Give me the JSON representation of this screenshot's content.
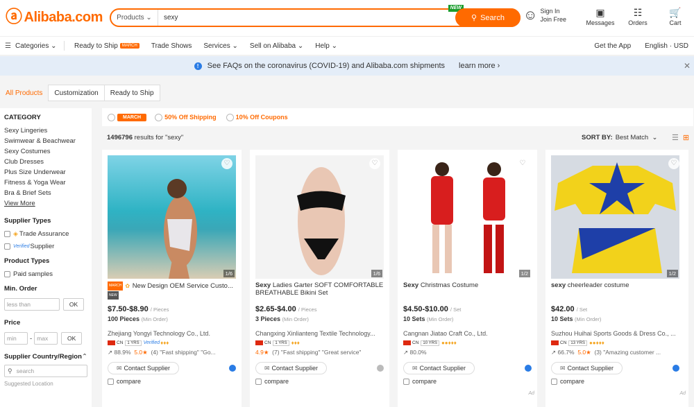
{
  "header": {
    "logo": "Alibaba.com",
    "search": {
      "category": "Products",
      "query": "sexy",
      "button": "Search",
      "new_badge": "NEW"
    },
    "signin": [
      "Sign In",
      "Join Free"
    ],
    "items": [
      "Messages",
      "Orders",
      "Cart"
    ]
  },
  "nav": {
    "categories": "Categories",
    "items": [
      "Ready to Ship",
      "Trade Shows",
      "Services",
      "Sell on Alibaba",
      "Help"
    ],
    "march_tag": "MARCH",
    "right": [
      "Get the App",
      "English · USD"
    ]
  },
  "notice": {
    "text": "See FAQs on the coronavirus (COVID-19) and Alibaba.com shipments",
    "link": "learn more"
  },
  "tabs": [
    "All Products",
    "Customization",
    "Ready to Ship"
  ],
  "sidebar": {
    "category_title": "CATEGORY",
    "categories": [
      "Sexy Lingeries",
      "Swimwear & Beachwear",
      "Sexy Costumes",
      "Club Dresses",
      "Plus Size Underwear",
      "Fitness & Yoga Wear",
      "Bra & Brief Sets"
    ],
    "view_more": "View More",
    "supplier_types_title": "Supplier Types",
    "supplier_types": [
      "Trade Assurance",
      "Supplier"
    ],
    "verified": "Verified",
    "product_types_title": "Product Types",
    "product_types": [
      "Paid samples"
    ],
    "min_order_title": "Min. Order",
    "min_order_placeholder": "less than",
    "ok": "OK",
    "price_title": "Price",
    "price_min": "min",
    "price_max": "max",
    "country_title": "Supplier Country/Region",
    "country_search": "search",
    "suggested": "Suggested Location"
  },
  "filters": {
    "march": "MARCH",
    "shipping": "50% Off Shipping",
    "coupons": "10% Off Coupons"
  },
  "results": {
    "count": "1496796",
    "text": "results for \"sexy\""
  },
  "sort": {
    "label": "SORT BY:",
    "value": "Best Match"
  },
  "products": [
    {
      "kw": "",
      "title": "New Design OEM Service Custo...",
      "price": "$7.50-$8.90",
      "price_unit": "/ Pieces",
      "moq": "100 Pieces",
      "moq_unit": "(Min Order)",
      "company": "Zhejiang Yongyi Technology Co., Ltd.",
      "country": "CN",
      "yrs": "1 YRS",
      "stats": [
        "88.9%",
        "5.0★",
        "(4) \"Fast shipping\" \"Go..."
      ],
      "page": "1/6",
      "img_color": "#3fb8c6"
    },
    {
      "kw": "Sexy",
      "title": " Ladies Garter SOFT COMFORTABLE BREATHABLE Bikini Set",
      "price": "$2.65-$4.00",
      "price_unit": "/ Pieces",
      "moq": "3 Pieces",
      "moq_unit": "(Min Order)",
      "company": "Changxing Xinlianteng Textile Technology...",
      "country": "CN",
      "yrs": "1 YRS",
      "stats": [
        "4.9★",
        "(7) \"Fast shipping\" \"Great service\""
      ],
      "page": "1/6",
      "img_color": "#f2f2f2"
    },
    {
      "kw": "Sexy",
      "title": " Christmas Costume",
      "price": "$4.50-$10.00",
      "price_unit": "/ Set",
      "moq": "10 Sets",
      "moq_unit": "(Min Order)",
      "company": "Cangnan Jiatao Craft Co., Ltd.",
      "country": "CN",
      "yrs": "10 YRS",
      "stats": [
        "80.0%"
      ],
      "page": "1/2",
      "img_color": "#ffffff"
    },
    {
      "kw": "sexy",
      "title": " cheerleader costume",
      "price": "$42.00",
      "price_unit": "/ Set",
      "moq": "10 Sets",
      "moq_unit": "(Min Order)",
      "company": "Suzhou Huihai Sports Goods & Dress Co., ...",
      "country": "CN",
      "yrs": "13 YRS",
      "stats": [
        "66.7%",
        "5.0★",
        "(3) \"Amazing customer ..."
      ],
      "page": "1/2",
      "img_color": "#d8dde3"
    }
  ],
  "card_labels": {
    "contact": "Contact Supplier",
    "compare": "compare",
    "ad": "Ad",
    "march": "MARCH",
    "new": "NEW"
  }
}
